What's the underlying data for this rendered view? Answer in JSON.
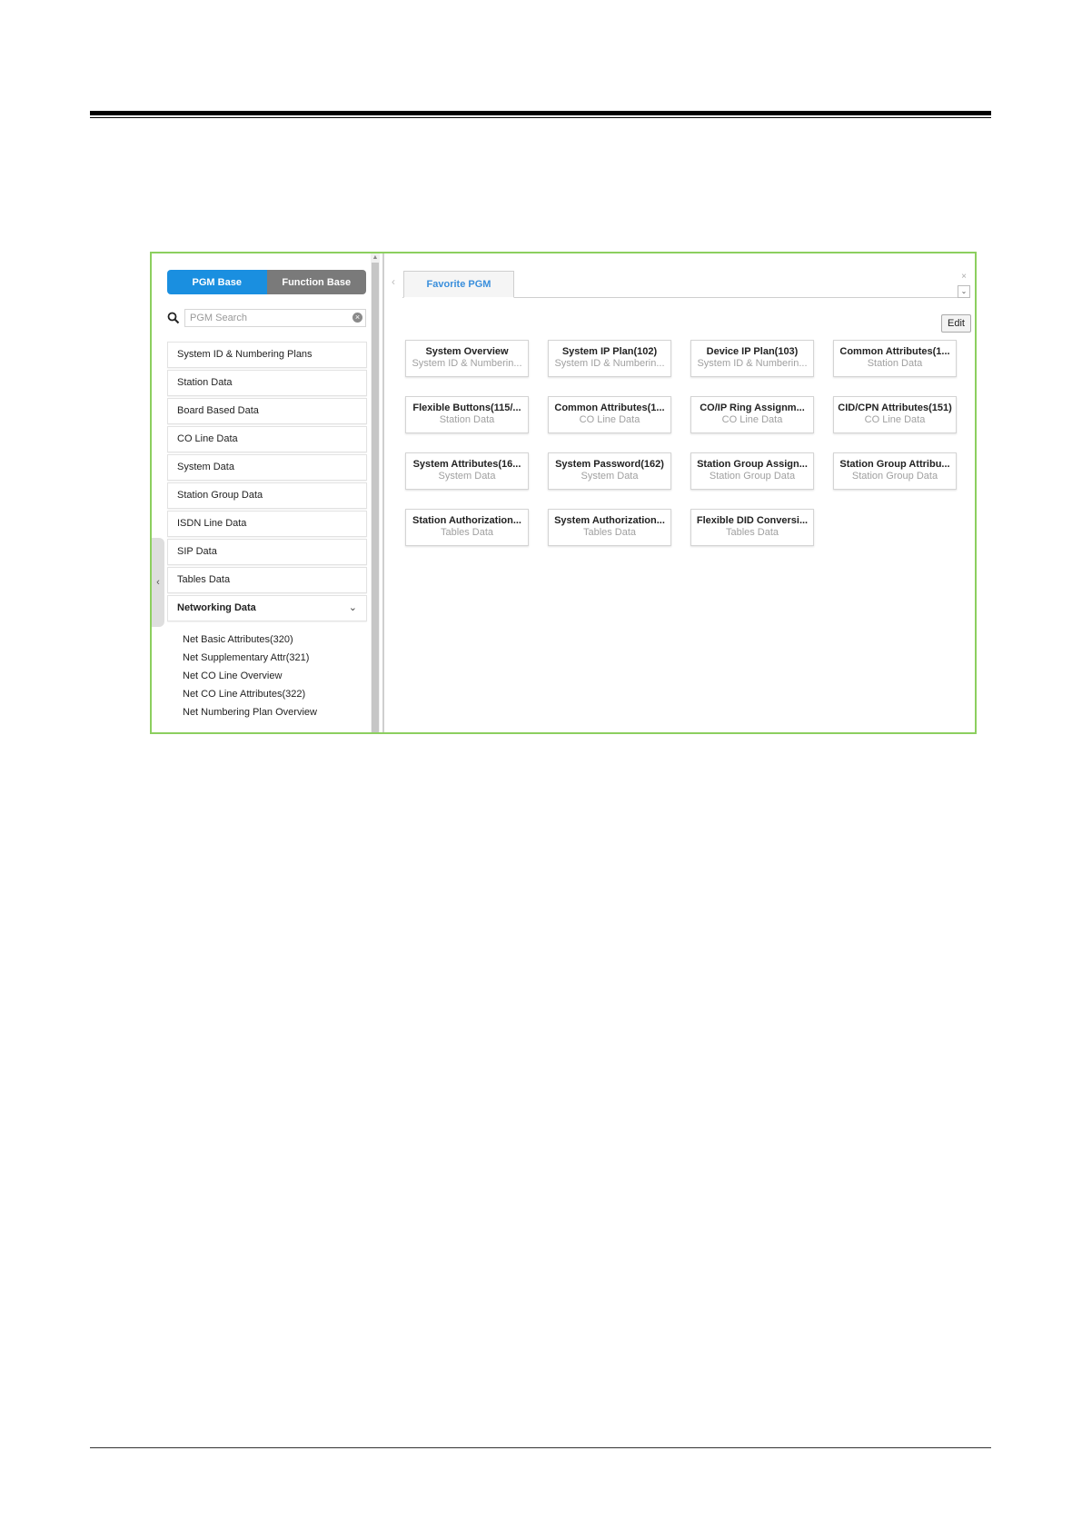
{
  "segmented": {
    "pgm_base": "PGM Base",
    "function_base": "Function Base"
  },
  "search": {
    "placeholder": "PGM Search",
    "clear": "×"
  },
  "menu": {
    "items": [
      "System ID & Numbering Plans",
      "Station Data",
      "Board Based Data",
      "CO Line Data",
      "System Data",
      "Station Group Data",
      "ISDN Line Data",
      "SIP Data",
      "Tables Data"
    ],
    "expanded": {
      "label": "Networking Data",
      "chevron": "⌄"
    },
    "subitems": [
      "Net Basic Attributes(320)",
      "Net Supplementary Attr(321)",
      "Net CO Line Overview",
      "Net CO Line Attributes(322)",
      "Net Numbering Plan Overview"
    ]
  },
  "tabs": {
    "active": "Favorite PGM",
    "left_arrow": "‹",
    "close": "×",
    "dropdown": "⌄"
  },
  "edit_label": "Edit",
  "collapse_glyph": "‹",
  "cards": [
    {
      "title": "System Overview",
      "sub": "System ID & Numberin..."
    },
    {
      "title": "System IP Plan(102)",
      "sub": "System ID & Numberin..."
    },
    {
      "title": "Device IP Plan(103)",
      "sub": "System ID & Numberin..."
    },
    {
      "title": "Common Attributes(1...",
      "sub": "Station Data"
    },
    {
      "title": "Flexible Buttons(115/...",
      "sub": "Station Data"
    },
    {
      "title": "Common Attributes(1...",
      "sub": "CO Line Data"
    },
    {
      "title": "CO/IP Ring Assignm...",
      "sub": "CO Line Data"
    },
    {
      "title": "CID/CPN Attributes(151)",
      "sub": "CO Line Data"
    },
    {
      "title": "System Attributes(16...",
      "sub": "System Data"
    },
    {
      "title": "System Password(162)",
      "sub": "System Data"
    },
    {
      "title": "Station Group Assign...",
      "sub": "Station Group Data"
    },
    {
      "title": "Station Group Attribu...",
      "sub": "Station Group Data"
    },
    {
      "title": "Station Authorization...",
      "sub": "Tables Data"
    },
    {
      "title": "System Authorization...",
      "sub": "Tables Data"
    },
    {
      "title": "Flexible DID Conversi...",
      "sub": "Tables Data"
    }
  ],
  "colors": {
    "frame_border": "#8ccf5f",
    "active_tab": "#1a8fe0",
    "inactive_tab": "#7a7a7a",
    "tab_text": "#3a8fdc"
  }
}
